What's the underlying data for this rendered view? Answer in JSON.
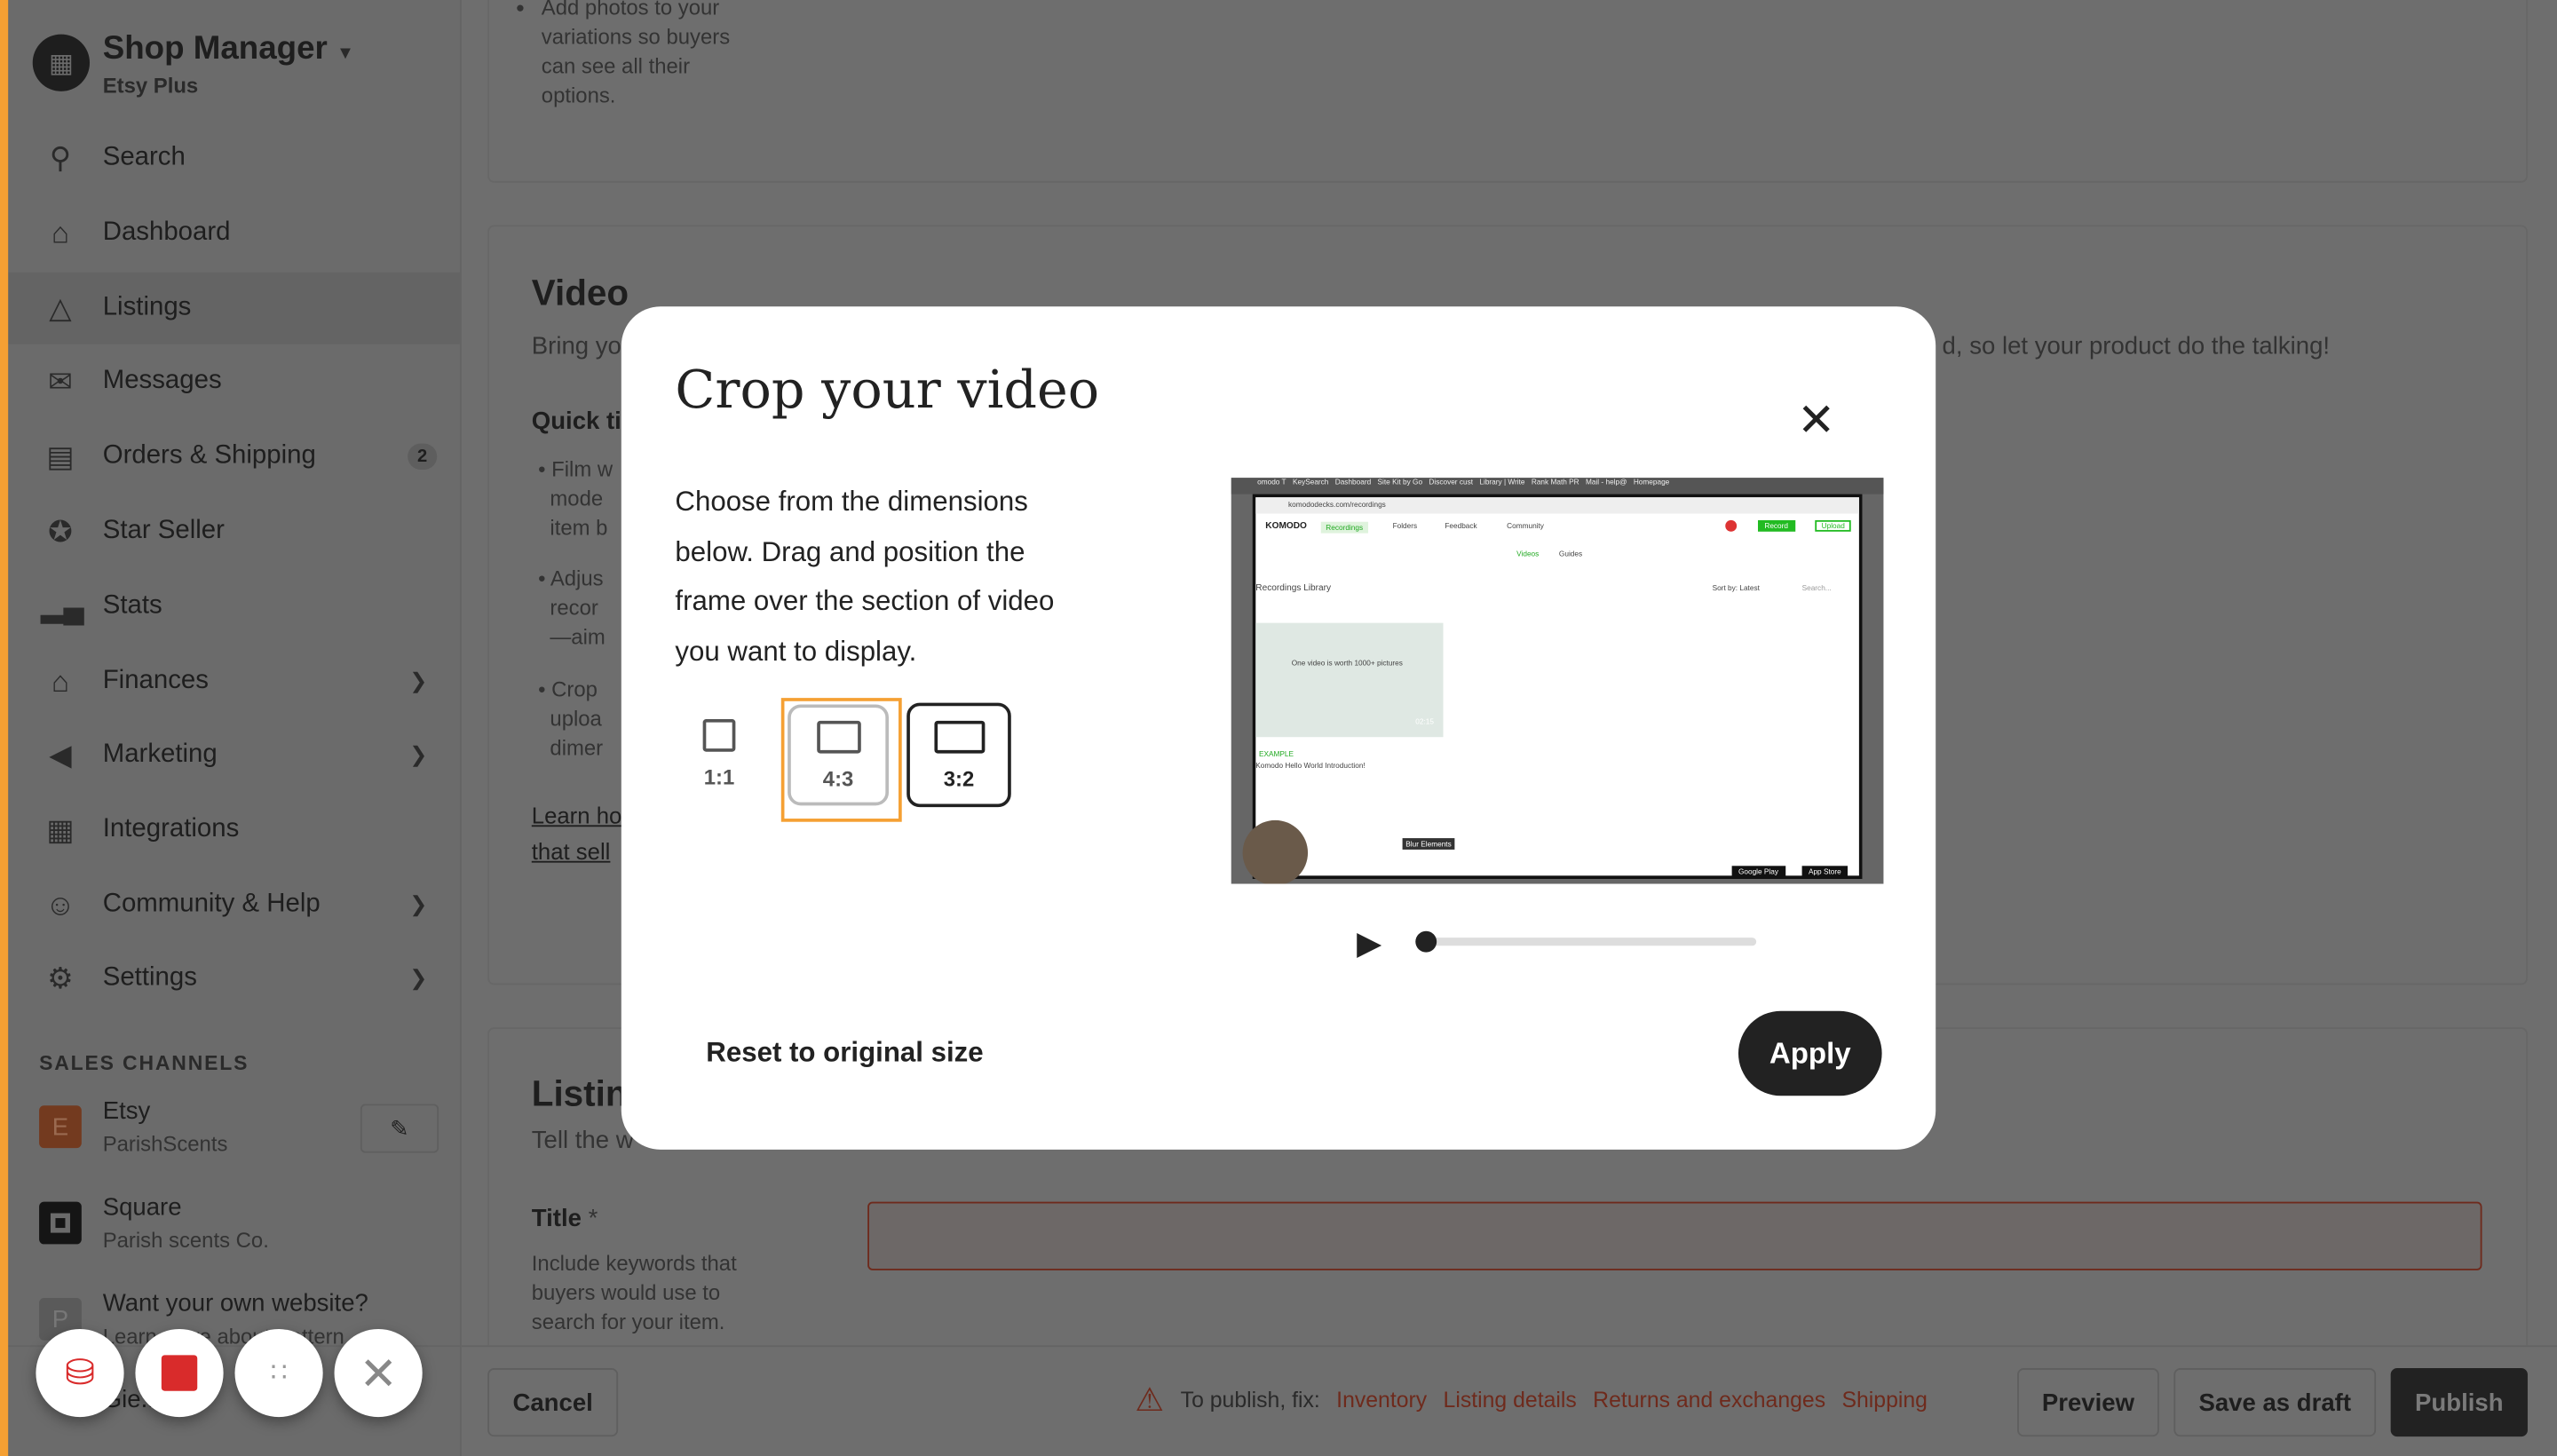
{
  "sidebar": {
    "brand_title": "Shop Manager",
    "brand_subtitle": "Etsy Plus",
    "items": [
      {
        "label": "Search",
        "icon": "search-icon"
      },
      {
        "label": "Dashboard",
        "icon": "home-icon"
      },
      {
        "label": "Listings",
        "icon": "shapes-icon",
        "active": true
      },
      {
        "label": "Messages",
        "icon": "envelope-icon"
      },
      {
        "label": "Orders & Shipping",
        "icon": "clipboard-icon",
        "badge": "2"
      },
      {
        "label": "Star Seller",
        "icon": "star-badge-icon"
      },
      {
        "label": "Stats",
        "icon": "bar-chart-icon"
      },
      {
        "label": "Finances",
        "icon": "bank-icon"
      },
      {
        "label": "Marketing",
        "icon": "megaphone-icon"
      },
      {
        "label": "Integrations",
        "icon": "grid-icon"
      },
      {
        "label": "Community & Help",
        "icon": "people-icon"
      },
      {
        "label": "Settings",
        "icon": "gear-icon"
      }
    ],
    "sales_channels_title": "SALES CHANNELS",
    "channels": [
      {
        "initial": "E",
        "name": "Etsy",
        "sub": "ParishScents",
        "color": "#f1641e"
      },
      {
        "initial": "",
        "name": "Square",
        "sub": "Parish scents Co.",
        "color": "#222222"
      },
      {
        "initial": "P",
        "name": "Want your own website?",
        "sub": "Learn more about Pattern",
        "color": "#aaaaaa"
      }
    ],
    "bottom_partial": "Gie... ue"
  },
  "main": {
    "photos_tip": [
      "Add photos to your",
      "variations so buyers",
      "can see all their",
      "options."
    ],
    "video_title": "Video",
    "video_desc_left": "Bring yo",
    "video_desc_right": "d, so let your product do the talking!",
    "quick_tips": "Quick ti",
    "tips": [
      [
        "Film w",
        "mode",
        "item b"
      ],
      [
        "Adjus",
        "recor",
        "—aim"
      ],
      [
        "Crop",
        "uploa",
        "dimer"
      ]
    ],
    "learn_link": [
      "Learn ho",
      "that sell"
    ],
    "listing_title": "Listin",
    "listing_desc": "Tell the w",
    "title_label": "Title",
    "title_required": "*",
    "title_help": [
      "Include keywords that",
      "buyers would use to",
      "search for your item."
    ]
  },
  "footer": {
    "cancel": "Cancel",
    "fix_prefix": "To publish, fix:",
    "fix_links": [
      "Inventory",
      "Listing details",
      "Returns and exchanges",
      "Shipping"
    ],
    "preview": "Preview",
    "save_draft": "Save as draft",
    "publish": "Publish"
  },
  "modal": {
    "title": "Crop your video",
    "description": [
      "Choose from the dimensions",
      "below. Drag and position the",
      "frame over the section of video",
      "you want to display."
    ],
    "ratios": [
      {
        "label": "1:1",
        "selected": false
      },
      {
        "label": "4:3",
        "selected": false,
        "focused": true
      },
      {
        "label": "3:2",
        "selected": true
      }
    ],
    "reset": "Reset to original size",
    "apply": "Apply",
    "playback_progress": 0,
    "video_frame": {
      "tabs": [
        "omodo T",
        "KeySearch",
        "Dashboard",
        "Site Kit by Go",
        "Discover cust",
        "Library | Write",
        "Rank Math PR",
        "Mail - help@",
        "Homepage"
      ],
      "url": "komododecks.com/recordings",
      "logo": "KOMODO",
      "nav": [
        "Recordings",
        "Folders",
        "Feedback",
        "Community"
      ],
      "record": "Record",
      "upload": "Upload",
      "subtabs": [
        "Videos",
        "Guides"
      ],
      "library": "Recordings Library",
      "sort": "Sort by: Latest",
      "search": "Search...",
      "card_badge": "EXAMPLE",
      "card_title": "Komodo Hello World Introduction!",
      "thumb_heading": "One video is worth 1000+ pictures",
      "duration": "02:15",
      "tooltip": "Blur Elements",
      "google_play": "Google Play",
      "app_store": "App Store"
    }
  },
  "colors": {
    "accent": "#f5a033",
    "record_red": "#d92b2b",
    "warning": "#c1452b"
  }
}
